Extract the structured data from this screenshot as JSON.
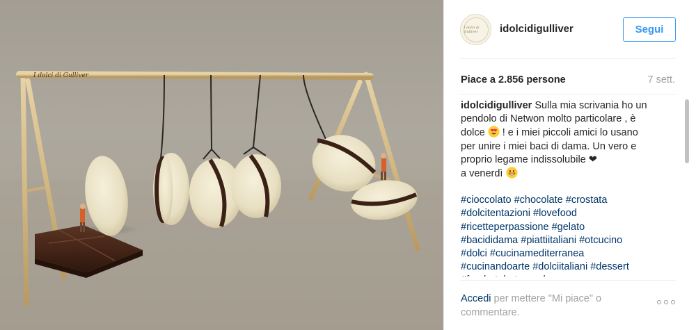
{
  "photo": {
    "alt_watermark": "I dolci di Gulliver"
  },
  "header": {
    "username": "idolcidigulliver",
    "avatar_text": "I dolci di Gulliver",
    "follow_label": "Segui"
  },
  "stats": {
    "likes": "Piace a 2.856 persone",
    "timestamp": "7 sett."
  },
  "caption": {
    "author": "idolcidigulliver",
    "line1_rest": " Sulla mia scrivania ho un",
    "line2": "pendolo di Netwon molto particolare , è",
    "line3_start": "dolce ",
    "line3_end": " ! e i miei piccoli amici lo usano",
    "line4": "per unire i miei baci di dama. Un vero e",
    "line5": "proprio legame indissolubile ❤",
    "line6": "a venerdì "
  },
  "hashtags": {
    "line1": [
      "#cioccolato",
      "#chocolate",
      "#crostata"
    ],
    "line2": [
      "#dolcitentazioni",
      "#lovefood"
    ],
    "line3": [
      "#ricetteperpassione",
      "#gelato"
    ],
    "line4": [
      "#bacididama",
      "#piattiitaliani",
      "#otcucino"
    ],
    "line5": [
      "#dolci",
      "#cucinamediterranea"
    ],
    "line6": [
      "#cucinandoarte",
      "#dolciitaliani",
      "#dessert"
    ],
    "line7": [
      "#foodartphotography"
    ]
  },
  "footer": {
    "login_link": "Accedi",
    "login_rest": " per mettere \"Mi piace\" o commentare."
  },
  "colors": {
    "follow": "#3897f0",
    "link": "#003569",
    "muted": "#a0a0a0"
  },
  "icons": {
    "heart_eyes": "smiling-face-with-heart-eyes-icon",
    "grin": "grinning-face-icon",
    "more": "ellipsis-icon"
  }
}
